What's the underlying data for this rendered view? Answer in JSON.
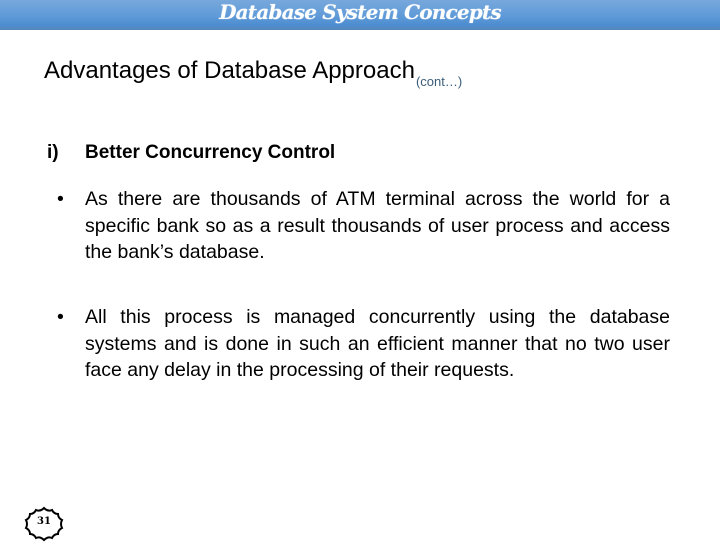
{
  "header": {
    "title": "Database System Concepts",
    "colors": {
      "band_top": "#78a8dc",
      "band_bottom": "#4c8ccf",
      "text": "#ffffff"
    }
  },
  "slide": {
    "title": "Advantages of Database Approach",
    "title_suffix": "(cont…)",
    "section": {
      "number": "i)",
      "heading": "Better Concurrency Control"
    },
    "bullets": [
      {
        "marker": "•",
        "text": "As there are  thousands  of  ATM  terminal  across  the world  for  a  specific  bank  so  as  a  result thousands of  user  process  and  access  the  bank’s  database."
      },
      {
        "marker": "•",
        "text": "All this process   is managed concurrently using   the database systems and   is done   in such an efficient manner   that no two user face any delay in the processing of their requests."
      }
    ],
    "page_number": "31"
  }
}
